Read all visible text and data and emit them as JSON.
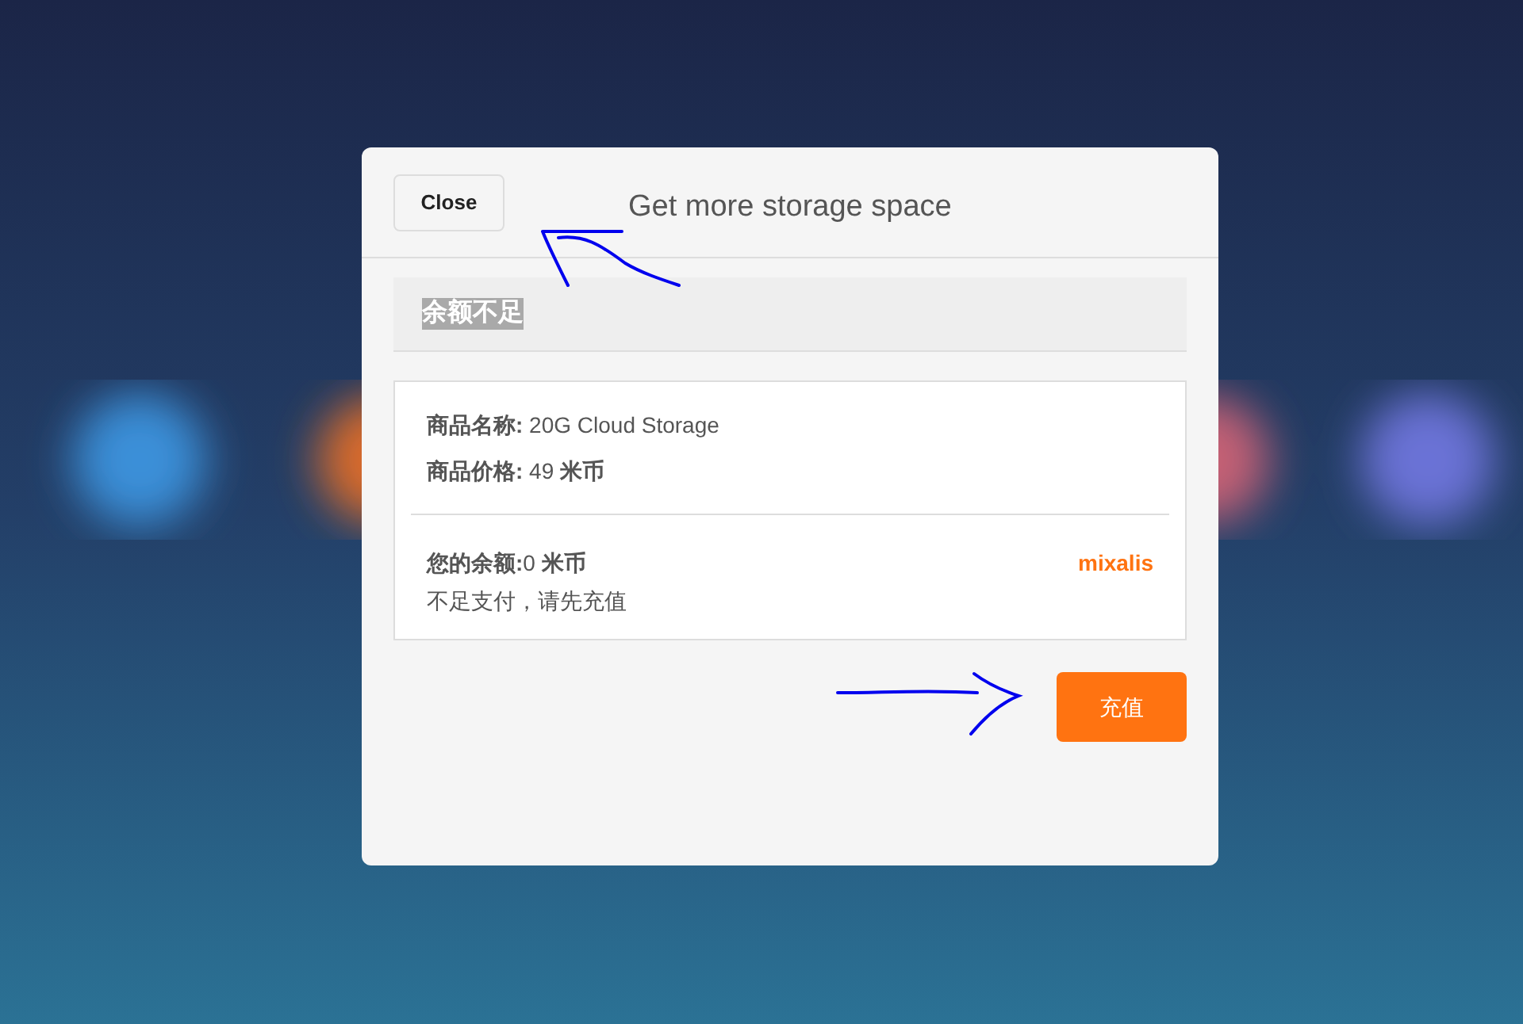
{
  "dialog": {
    "close_button": "Close",
    "title": "Get more storage space"
  },
  "alert": {
    "text": "余额不足",
    "highlighted": true
  },
  "product": {
    "name": "**商品名称:** 20G Cloud Storage",
    "price": "**商品价格:** 49 **米币**"
  },
  "account": {
    "balance": "**您的余额:**0 **米币**",
    "message": "不足支付，请先充值",
    "username": "mixalis"
  },
  "action_button": "充值"
}
